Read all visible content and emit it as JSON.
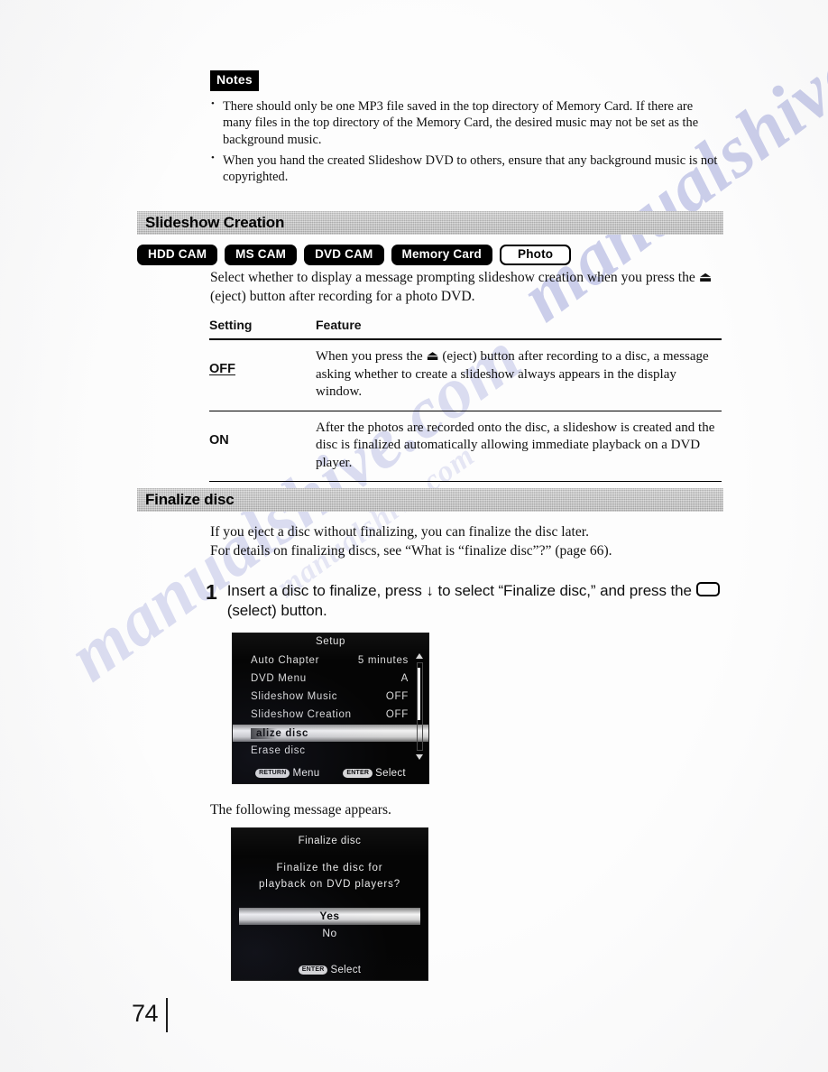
{
  "notes": {
    "tag": "Notes",
    "items": [
      "There should only be one MP3 file saved in the top directory of Memory Card. If there are many files in the top directory of the Memory Card, the desired music may not be set as the background music.",
      "When you hand the created Slideshow DVD to others, ensure that any background music is not copyrighted."
    ]
  },
  "sections": {
    "slideshow_creation": {
      "heading": "Slideshow Creation",
      "badges": [
        {
          "label": "HDD CAM",
          "style": "solid"
        },
        {
          "label": "MS CAM",
          "style": "solid"
        },
        {
          "label": "DVD CAM",
          "style": "solid"
        },
        {
          "label": "Memory Card",
          "style": "solid"
        },
        {
          "label": "Photo",
          "style": "outline"
        }
      ],
      "intro": "Select whether to display a message prompting slideshow creation when you press the ⏏ (eject) button after recording for a photo DVD.",
      "table": {
        "headers": [
          "Setting",
          "Feature"
        ],
        "rows": [
          {
            "setting": "OFF",
            "default": true,
            "feature": "When you press the ⏏ (eject) button after recording to a disc, a message asking whether to create a slideshow always appears in the display window."
          },
          {
            "setting": "ON",
            "default": false,
            "feature": "After the photos are recorded onto the disc, a slideshow is created and the disc is finalized automatically allowing immediate playback on a DVD player."
          }
        ]
      }
    },
    "finalize_disc": {
      "heading": "Finalize disc",
      "intro": "If you eject a disc without finalizing, you can finalize the disc later.\nFor details on finalizing discs, see “What is “finalize disc”?” (page 66).",
      "step": {
        "number": "1",
        "text_before_key": "Insert a disc to finalize, press ↓ to select “Finalize disc,” and press the",
        "text_after_key": "(select) button."
      },
      "after_step_caption": "The following message appears."
    }
  },
  "lcd_setup": {
    "title": "Setup",
    "items": [
      {
        "label": "Auto Chapter",
        "value": "5 minutes",
        "selected": false
      },
      {
        "label": "DVD Menu",
        "value": "A",
        "selected": false
      },
      {
        "label": "Slideshow Music",
        "value": "OFF",
        "selected": false
      },
      {
        "label": "Slideshow Creation",
        "value": "OFF",
        "selected": false
      },
      {
        "label": "alize disc",
        "value": "",
        "selected": true
      },
      {
        "label": "Erase disc",
        "value": "",
        "selected": false
      }
    ],
    "footer": [
      {
        "key": "RETURN",
        "label": "Menu"
      },
      {
        "key": "ENTER",
        "label": "Select"
      }
    ]
  },
  "lcd_confirm": {
    "title": "Finalize disc",
    "message_line_1": "Finalize the disc for",
    "message_line_2": "playback on DVD players?",
    "options": [
      {
        "label": "Yes",
        "selected": true
      },
      {
        "label": "No",
        "selected": false
      }
    ],
    "footer": [
      {
        "key": "ENTER",
        "label": "Select"
      }
    ]
  },
  "page_number": "74",
  "watermark": {
    "line_1": "manualshive.com",
    "line_2": "manualshive.com",
    "line_3": "manualshive.com"
  }
}
